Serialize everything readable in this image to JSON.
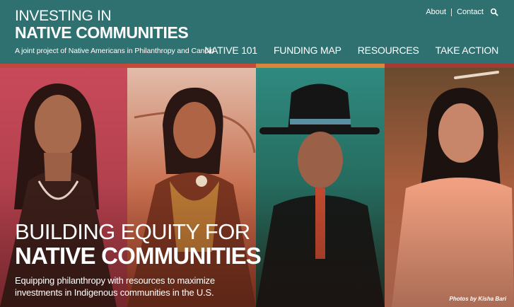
{
  "header": {
    "logo_line1": "INVESTING IN",
    "logo_line2": "NATIVE COMMUNITIES",
    "tagline": "A joint project of Native Americans in Philanthropy and Candid"
  },
  "utility_nav": {
    "about": "About",
    "contact": "Contact",
    "search_icon": "search-icon"
  },
  "main_nav": [
    {
      "label": "NATIVE 101"
    },
    {
      "label": "FUNDING MAP"
    },
    {
      "label": "RESOURCES"
    },
    {
      "label": "TAKE ACTION"
    }
  ],
  "hero": {
    "title_line1": "BUILDING EQUITY FOR",
    "title_line2": "NATIVE COMMUNITIES",
    "subtitle": "Equipping philanthropy with resources to maximize investments in Indigenous communities in the U.S.",
    "photo_credit": "Photos by Kisha Bari"
  },
  "colors": {
    "header_bg": "#2f7170",
    "strip_colors": [
      "#c0483f",
      "#c44a3a",
      "#d6873a",
      "#a33b33"
    ],
    "panel1": "#b5404c",
    "panel2": "#c25a38",
    "panel3": "#2e7268",
    "panel4": "#8c4a32"
  }
}
